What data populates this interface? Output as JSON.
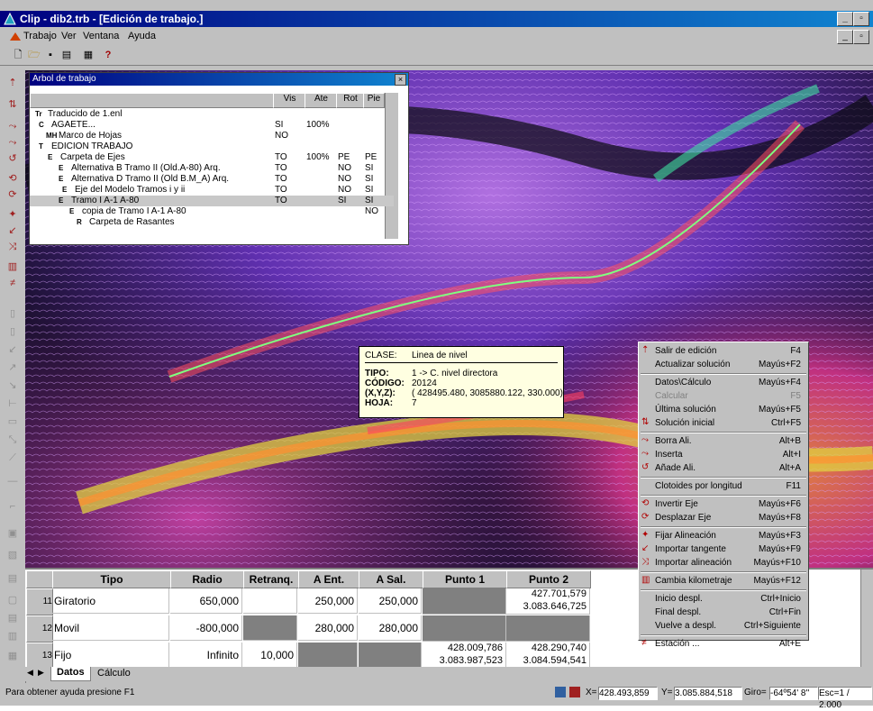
{
  "window": {
    "title": "Clip - dib2.trb - [Edición de trabajo.]"
  },
  "menu": {
    "items": [
      "Trabajo",
      "Ver",
      "Ventana",
      "Ayuda"
    ]
  },
  "tree": {
    "title": "Arbol de trabajo",
    "columns": [
      "Vis",
      "Ate",
      "Rot",
      "Pie"
    ],
    "rows": [
      {
        "label": "Traducido de 1.enl",
        "vis": "",
        "ate": "",
        "rot": "",
        "pie": ""
      },
      {
        "label": "AGAETE...",
        "vis": "SI",
        "ate": "100%",
        "rot": "",
        "pie": ""
      },
      {
        "label": "Marco de Hojas",
        "vis": "NO",
        "ate": "",
        "rot": "",
        "pie": ""
      },
      {
        "label": "EDICION TRABAJO",
        "vis": "",
        "ate": "",
        "rot": "",
        "pie": ""
      },
      {
        "label": "Carpeta de Ejes",
        "vis": "TO",
        "ate": "100%",
        "rot": "PE",
        "pie": "PE"
      },
      {
        "label": "Alternativa B Tramo II (Old.A-80) Arq.",
        "vis": "TO",
        "ate": "",
        "rot": "NO",
        "pie": "SI"
      },
      {
        "label": "Alternativa D Tramo II (Old B.M_A) Arq.",
        "vis": "TO",
        "ate": "",
        "rot": "NO",
        "pie": "SI"
      },
      {
        "label": "Eje del Modelo Tramos i y ii",
        "vis": "TO",
        "ate": "",
        "rot": "NO",
        "pie": "SI"
      },
      {
        "label": "Tramo I A-1  A-80",
        "vis": "TO",
        "ate": "",
        "rot": "SI",
        "pie": "SI"
      },
      {
        "label": "copia de Tramo I A-1 A-80",
        "vis": "",
        "ate": "",
        "rot": "",
        "pie": "NO"
      },
      {
        "label": "Carpeta de Rasantes",
        "vis": "",
        "ate": "",
        "rot": "",
        "pie": ""
      }
    ]
  },
  "tooltip": {
    "clase_label": "CLASE:",
    "clase": "Linea de nivel",
    "tipo_label": "TIPO:",
    "tipo": "1 -> C. nivel directora",
    "codigo_label": "CÓDIGO:",
    "codigo": "20124",
    "xyz_label": "(X,Y,Z):",
    "xyz": "( 428495.480,  3085880.122,  330.000)",
    "hoja_label": "HOJA:",
    "hoja": "7"
  },
  "context_menu": [
    {
      "label": "Salir de edición",
      "shortcut": "F4",
      "icon": "exit-edit-icon"
    },
    {
      "label": "Actualizar solución",
      "shortcut": "Mayús+F2"
    },
    {
      "sep": true
    },
    {
      "label": "Datos\\Cálculo",
      "shortcut": "Mayús+F4"
    },
    {
      "label": "Calcular",
      "shortcut": "F5",
      "disabled": true
    },
    {
      "label": "Última solución",
      "shortcut": "Mayús+F5"
    },
    {
      "label": "Solución inicial",
      "shortcut": "Ctrl+F5",
      "icon": "initial-solution-icon"
    },
    {
      "sep": true
    },
    {
      "label": "Borra Ali.",
      "shortcut": "Alt+B",
      "icon": "delete-alignment-icon"
    },
    {
      "label": "Inserta",
      "shortcut": "Alt+I",
      "icon": "insert-alignment-icon"
    },
    {
      "label": "Añade Ali.",
      "shortcut": "Alt+A",
      "icon": "add-alignment-icon"
    },
    {
      "sep": true
    },
    {
      "label": "Clotoides por longitud",
      "shortcut": "F11"
    },
    {
      "sep": true
    },
    {
      "label": "Invertir Eje",
      "shortcut": "Mayús+F6",
      "icon": "invert-axis-icon"
    },
    {
      "label": "Desplazar Eje",
      "shortcut": "Mayús+F8",
      "icon": "move-axis-icon"
    },
    {
      "sep": true
    },
    {
      "label": "Fijar Alineación",
      "shortcut": "Mayús+F3",
      "icon": "fix-alignment-icon"
    },
    {
      "label": "Importar tangente",
      "shortcut": "Mayús+F9",
      "icon": "import-tangent-icon"
    },
    {
      "label": "Importar alineación",
      "shortcut": "Mayús+F10",
      "icon": "import-alignment-icon"
    },
    {
      "sep": true
    },
    {
      "label": "Cambia kilometraje",
      "shortcut": "Mayús+F12",
      "icon": "change-km-icon"
    },
    {
      "sep": true
    },
    {
      "label": "Inicio despl.",
      "shortcut": "Ctrl+Inicio"
    },
    {
      "label": "Final despl.",
      "shortcut": "Ctrl+Fin"
    },
    {
      "label": "Vuelve a despl.",
      "shortcut": "Ctrl+Siguiente"
    },
    {
      "sep": true
    },
    {
      "label": "Estación ...",
      "shortcut": "Alt+E",
      "icon": "station-icon"
    }
  ],
  "grid": {
    "columns": [
      "Tipo",
      "Radio",
      "Retranq.",
      "A Ent.",
      "A Sal.",
      "Punto 1",
      "Punto 2"
    ],
    "rows": [
      {
        "num": "11",
        "tipo": "Giratorio",
        "radio": "650,000",
        "retranq": "",
        "aent": "250,000",
        "asal": "250,000",
        "p1a": "",
        "p1b": "",
        "p2a": "427.701,579",
        "p2b": "3.083.646,725"
      },
      {
        "num": "12",
        "tipo": "Movil",
        "radio": "-800,000",
        "retranq": "",
        "aent": "280,000",
        "asal": "280,000",
        "p1a": "",
        "p1b": "",
        "p2a": "",
        "p2b": ""
      },
      {
        "num": "13",
        "tipo": "Fijo",
        "radio": "Infinito",
        "retranq": "10,000",
        "aent": "",
        "asal": "",
        "p1a": "428.009,786",
        "p1b": "3.083.987,523",
        "p2a": "428.290,740",
        "p2b": "3.084.594,541"
      }
    ]
  },
  "tabs": {
    "datos": "Datos",
    "calculo": "Cálculo"
  },
  "status": {
    "help": "Para obtener ayuda presione F1",
    "x_label": "X=",
    "x": "428.493,859",
    "y_label": "Y=",
    "y": "3.085.884,518",
    "giro_label": "Giro=",
    "giro": "-64º54' 8''",
    "esc": "Esc=1 / 2.000"
  }
}
